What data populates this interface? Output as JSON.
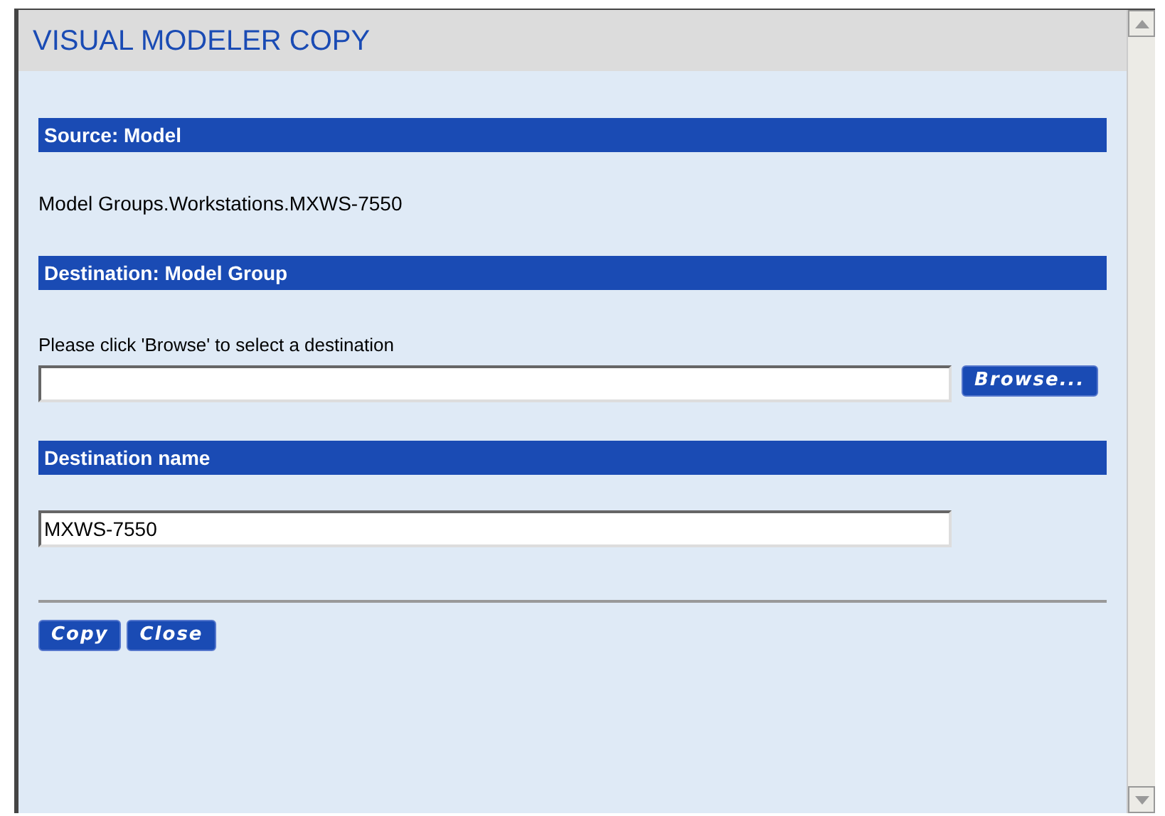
{
  "window": {
    "title": "VISUAL MODELER COPY"
  },
  "sections": [
    {
      "kind": "text",
      "heading": "Source: Model",
      "text": "Model Groups.Workstations.MXWS-7550"
    },
    {
      "kind": "browse",
      "heading": "Destination: Model Group",
      "label": "Please click 'Browse' to select a destination",
      "button": "Browse..."
    },
    {
      "kind": "input",
      "heading": "Destination name",
      "value": "MXWS-7550"
    }
  ],
  "buttons": [
    "Copy",
    "Close"
  ]
}
